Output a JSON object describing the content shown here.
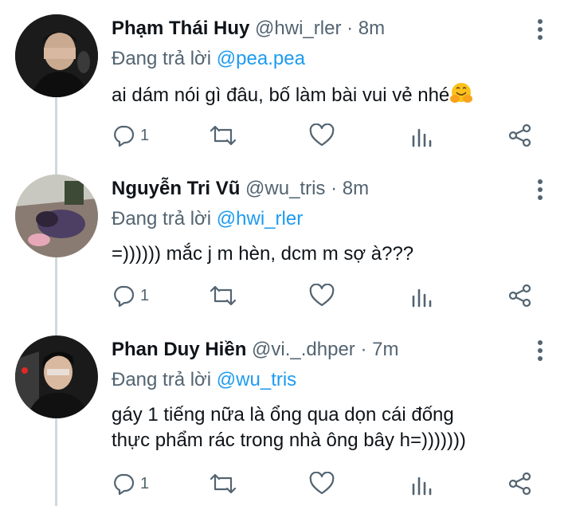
{
  "tweets": [
    {
      "name": "Phạm Thái Huy",
      "handle": "@hwi_rler",
      "time": "· 8m",
      "replying_label": "Đang trả lời ",
      "replying_to": "@pea.pea",
      "text": "ai dám nói gì đâu, bố làm bài vui vẻ nhé",
      "emoji": "hugging-face-emoji",
      "reply_count": "1",
      "avatar_color": "#2a2a2a"
    },
    {
      "name": "Nguyễn Tri Vũ",
      "handle": "@wu_tris",
      "time": "· 8m",
      "replying_label": "Đang trả lời ",
      "replying_to": "@hwi_rler",
      "text": "=)))))) mắc j m hèn, dcm m sợ à???",
      "reply_count": "1",
      "avatar_color": "#6b5a7a"
    },
    {
      "name": "Phan Duy Hiền",
      "handle": "@vi._.dhper",
      "time": "· 7m",
      "replying_label": "Đang trả lời ",
      "replying_to": "@wu_tris",
      "text_line1": "gáy 1 tiếng nữa là ổng qua dọn cái đống",
      "text_line2": "thực phẩm rác trong nhà ông bây h=)))))))",
      "reply_count": "1",
      "avatar_color": "#1e1e1e"
    }
  ],
  "colors": {
    "accent": "#1d9bf0",
    "secondary": "#536471",
    "thread": "#cfd9de"
  }
}
